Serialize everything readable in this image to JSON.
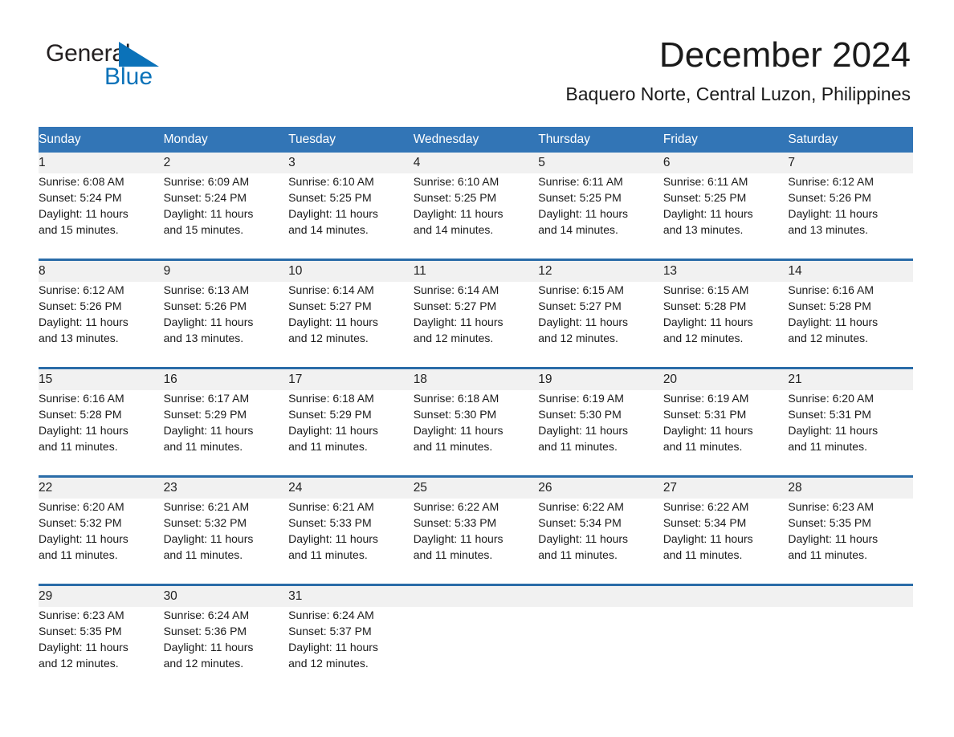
{
  "brand": {
    "logo_line1": "General",
    "logo_line2": "Blue",
    "logo_triangle_icon": "triangle-icon",
    "accent_color": "#0b72b9"
  },
  "header": {
    "month_title": "December 2024",
    "location": "Baquero Norte, Central Luzon, Philippines"
  },
  "theme": {
    "header_blue": "#3275b6",
    "separator_blue": "#2a6ca8",
    "daynum_band": "#f1f1f1"
  },
  "weekday_headers": [
    "Sunday",
    "Monday",
    "Tuesday",
    "Wednesday",
    "Thursday",
    "Friday",
    "Saturday"
  ],
  "weeks": [
    [
      {
        "day": "1",
        "sunrise": "Sunrise: 6:08 AM",
        "sunset": "Sunset: 5:24 PM",
        "daylight1": "Daylight: 11 hours",
        "daylight2": "and 15 minutes."
      },
      {
        "day": "2",
        "sunrise": "Sunrise: 6:09 AM",
        "sunset": "Sunset: 5:24 PM",
        "daylight1": "Daylight: 11 hours",
        "daylight2": "and 15 minutes."
      },
      {
        "day": "3",
        "sunrise": "Sunrise: 6:10 AM",
        "sunset": "Sunset: 5:25 PM",
        "daylight1": "Daylight: 11 hours",
        "daylight2": "and 14 minutes."
      },
      {
        "day": "4",
        "sunrise": "Sunrise: 6:10 AM",
        "sunset": "Sunset: 5:25 PM",
        "daylight1": "Daylight: 11 hours",
        "daylight2": "and 14 minutes."
      },
      {
        "day": "5",
        "sunrise": "Sunrise: 6:11 AM",
        "sunset": "Sunset: 5:25 PM",
        "daylight1": "Daylight: 11 hours",
        "daylight2": "and 14 minutes."
      },
      {
        "day": "6",
        "sunrise": "Sunrise: 6:11 AM",
        "sunset": "Sunset: 5:25 PM",
        "daylight1": "Daylight: 11 hours",
        "daylight2": "and 13 minutes."
      },
      {
        "day": "7",
        "sunrise": "Sunrise: 6:12 AM",
        "sunset": "Sunset: 5:26 PM",
        "daylight1": "Daylight: 11 hours",
        "daylight2": "and 13 minutes."
      }
    ],
    [
      {
        "day": "8",
        "sunrise": "Sunrise: 6:12 AM",
        "sunset": "Sunset: 5:26 PM",
        "daylight1": "Daylight: 11 hours",
        "daylight2": "and 13 minutes."
      },
      {
        "day": "9",
        "sunrise": "Sunrise: 6:13 AM",
        "sunset": "Sunset: 5:26 PM",
        "daylight1": "Daylight: 11 hours",
        "daylight2": "and 13 minutes."
      },
      {
        "day": "10",
        "sunrise": "Sunrise: 6:14 AM",
        "sunset": "Sunset: 5:27 PM",
        "daylight1": "Daylight: 11 hours",
        "daylight2": "and 12 minutes."
      },
      {
        "day": "11",
        "sunrise": "Sunrise: 6:14 AM",
        "sunset": "Sunset: 5:27 PM",
        "daylight1": "Daylight: 11 hours",
        "daylight2": "and 12 minutes."
      },
      {
        "day": "12",
        "sunrise": "Sunrise: 6:15 AM",
        "sunset": "Sunset: 5:27 PM",
        "daylight1": "Daylight: 11 hours",
        "daylight2": "and 12 minutes."
      },
      {
        "day": "13",
        "sunrise": "Sunrise: 6:15 AM",
        "sunset": "Sunset: 5:28 PM",
        "daylight1": "Daylight: 11 hours",
        "daylight2": "and 12 minutes."
      },
      {
        "day": "14",
        "sunrise": "Sunrise: 6:16 AM",
        "sunset": "Sunset: 5:28 PM",
        "daylight1": "Daylight: 11 hours",
        "daylight2": "and 12 minutes."
      }
    ],
    [
      {
        "day": "15",
        "sunrise": "Sunrise: 6:16 AM",
        "sunset": "Sunset: 5:28 PM",
        "daylight1": "Daylight: 11 hours",
        "daylight2": "and 11 minutes."
      },
      {
        "day": "16",
        "sunrise": "Sunrise: 6:17 AM",
        "sunset": "Sunset: 5:29 PM",
        "daylight1": "Daylight: 11 hours",
        "daylight2": "and 11 minutes."
      },
      {
        "day": "17",
        "sunrise": "Sunrise: 6:18 AM",
        "sunset": "Sunset: 5:29 PM",
        "daylight1": "Daylight: 11 hours",
        "daylight2": "and 11 minutes."
      },
      {
        "day": "18",
        "sunrise": "Sunrise: 6:18 AM",
        "sunset": "Sunset: 5:30 PM",
        "daylight1": "Daylight: 11 hours",
        "daylight2": "and 11 minutes."
      },
      {
        "day": "19",
        "sunrise": "Sunrise: 6:19 AM",
        "sunset": "Sunset: 5:30 PM",
        "daylight1": "Daylight: 11 hours",
        "daylight2": "and 11 minutes."
      },
      {
        "day": "20",
        "sunrise": "Sunrise: 6:19 AM",
        "sunset": "Sunset: 5:31 PM",
        "daylight1": "Daylight: 11 hours",
        "daylight2": "and 11 minutes."
      },
      {
        "day": "21",
        "sunrise": "Sunrise: 6:20 AM",
        "sunset": "Sunset: 5:31 PM",
        "daylight1": "Daylight: 11 hours",
        "daylight2": "and 11 minutes."
      }
    ],
    [
      {
        "day": "22",
        "sunrise": "Sunrise: 6:20 AM",
        "sunset": "Sunset: 5:32 PM",
        "daylight1": "Daylight: 11 hours",
        "daylight2": "and 11 minutes."
      },
      {
        "day": "23",
        "sunrise": "Sunrise: 6:21 AM",
        "sunset": "Sunset: 5:32 PM",
        "daylight1": "Daylight: 11 hours",
        "daylight2": "and 11 minutes."
      },
      {
        "day": "24",
        "sunrise": "Sunrise: 6:21 AM",
        "sunset": "Sunset: 5:33 PM",
        "daylight1": "Daylight: 11 hours",
        "daylight2": "and 11 minutes."
      },
      {
        "day": "25",
        "sunrise": "Sunrise: 6:22 AM",
        "sunset": "Sunset: 5:33 PM",
        "daylight1": "Daylight: 11 hours",
        "daylight2": "and 11 minutes."
      },
      {
        "day": "26",
        "sunrise": "Sunrise: 6:22 AM",
        "sunset": "Sunset: 5:34 PM",
        "daylight1": "Daylight: 11 hours",
        "daylight2": "and 11 minutes."
      },
      {
        "day": "27",
        "sunrise": "Sunrise: 6:22 AM",
        "sunset": "Sunset: 5:34 PM",
        "daylight1": "Daylight: 11 hours",
        "daylight2": "and 11 minutes."
      },
      {
        "day": "28",
        "sunrise": "Sunrise: 6:23 AM",
        "sunset": "Sunset: 5:35 PM",
        "daylight1": "Daylight: 11 hours",
        "daylight2": "and 11 minutes."
      }
    ],
    [
      {
        "day": "29",
        "sunrise": "Sunrise: 6:23 AM",
        "sunset": "Sunset: 5:35 PM",
        "daylight1": "Daylight: 11 hours",
        "daylight2": "and 12 minutes."
      },
      {
        "day": "30",
        "sunrise": "Sunrise: 6:24 AM",
        "sunset": "Sunset: 5:36 PM",
        "daylight1": "Daylight: 11 hours",
        "daylight2": "and 12 minutes."
      },
      {
        "day": "31",
        "sunrise": "Sunrise: 6:24 AM",
        "sunset": "Sunset: 5:37 PM",
        "daylight1": "Daylight: 11 hours",
        "daylight2": "and 12 minutes."
      },
      {
        "day": "",
        "sunrise": "",
        "sunset": "",
        "daylight1": "",
        "daylight2": ""
      },
      {
        "day": "",
        "sunrise": "",
        "sunset": "",
        "daylight1": "",
        "daylight2": ""
      },
      {
        "day": "",
        "sunrise": "",
        "sunset": "",
        "daylight1": "",
        "daylight2": ""
      },
      {
        "day": "",
        "sunrise": "",
        "sunset": "",
        "daylight1": "",
        "daylight2": ""
      }
    ]
  ]
}
